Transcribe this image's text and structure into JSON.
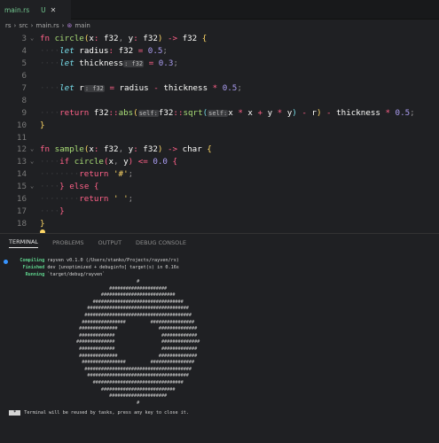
{
  "tab": {
    "name": "main.rs",
    "status": "U",
    "close": "✕"
  },
  "breadcrumb": [
    "rs",
    "src",
    "main.rs",
    "main"
  ],
  "code": [
    {
      "n": "3",
      "fold": true,
      "tokens": [
        [
          "kw",
          "fn "
        ],
        [
          "fn",
          "circle"
        ],
        [
          "p",
          "("
        ],
        [
          "id",
          "x"
        ],
        [
          "op",
          ": "
        ],
        [
          "ty",
          "f32"
        ],
        [
          "punct",
          ", "
        ],
        [
          "id",
          "y"
        ],
        [
          "op",
          ": "
        ],
        [
          "ty",
          "f32"
        ],
        [
          "p",
          ")"
        ],
        [
          "op",
          " -> "
        ],
        [
          "ty",
          "f32 "
        ],
        [
          "p",
          "{"
        ]
      ]
    },
    {
      "n": "4",
      "tokens": [
        [
          "ws",
          "····"
        ],
        [
          "let",
          "let "
        ],
        [
          "id",
          "radius"
        ],
        [
          "op",
          ": "
        ],
        [
          "ty",
          "f32 "
        ],
        [
          "op",
          "= "
        ],
        [
          "num",
          "0.5"
        ],
        [
          "punct",
          ";"
        ]
      ]
    },
    {
      "n": "5",
      "tokens": [
        [
          "ws",
          "····"
        ],
        [
          "let",
          "let "
        ],
        [
          "id",
          "thickness"
        ],
        [
          "hint",
          ": f32"
        ],
        [
          "op",
          " = "
        ],
        [
          "num",
          "0.3"
        ],
        [
          "punct",
          ";"
        ]
      ]
    },
    {
      "n": "6",
      "tokens": []
    },
    {
      "n": "7",
      "tokens": [
        [
          "ws",
          "····"
        ],
        [
          "let",
          "let "
        ],
        [
          "id",
          "r"
        ],
        [
          "hint",
          ": f32"
        ],
        [
          "op",
          " = "
        ],
        [
          "id",
          "radius "
        ],
        [
          "op",
          "- "
        ],
        [
          "id",
          "thickness "
        ],
        [
          "op",
          "* "
        ],
        [
          "num",
          "0.5"
        ],
        [
          "punct",
          ";"
        ]
      ]
    },
    {
      "n": "8",
      "tokens": []
    },
    {
      "n": "9",
      "tokens": [
        [
          "ws",
          "····"
        ],
        [
          "kw",
          "return "
        ],
        [
          "ty",
          "f32"
        ],
        [
          "op",
          "::"
        ],
        [
          "fn",
          "abs"
        ],
        [
          "p",
          "("
        ],
        [
          "hint",
          "self:"
        ],
        [
          "ty",
          "f32"
        ],
        [
          "op",
          "::"
        ],
        [
          "fn",
          "sqrt"
        ],
        [
          "p2",
          "("
        ],
        [
          "hint",
          "self:"
        ],
        [
          "id",
          "x "
        ],
        [
          "op",
          "* "
        ],
        [
          "id",
          "x "
        ],
        [
          "op",
          "+ "
        ],
        [
          "id",
          "y "
        ],
        [
          "op",
          "* "
        ],
        [
          "id",
          "y"
        ],
        [
          "p2",
          ")"
        ],
        [
          "op",
          " - "
        ],
        [
          "id",
          "r"
        ],
        [
          "p",
          ")"
        ],
        [
          "op",
          " - "
        ],
        [
          "id",
          "thickness "
        ],
        [
          "op",
          "* "
        ],
        [
          "num",
          "0.5"
        ],
        [
          "punct",
          ";"
        ]
      ]
    },
    {
      "n": "10",
      "tokens": [
        [
          "p",
          "}"
        ]
      ]
    },
    {
      "n": "11",
      "tokens": []
    },
    {
      "n": "12",
      "fold": true,
      "tokens": [
        [
          "kw",
          "fn "
        ],
        [
          "fn",
          "sample"
        ],
        [
          "p",
          "("
        ],
        [
          "id",
          "x"
        ],
        [
          "op",
          ": "
        ],
        [
          "ty",
          "f32"
        ],
        [
          "punct",
          ", "
        ],
        [
          "id",
          "y"
        ],
        [
          "op",
          ": "
        ],
        [
          "ty",
          "f32"
        ],
        [
          "p",
          ")"
        ],
        [
          "op",
          " -> "
        ],
        [
          "ty",
          "char "
        ],
        [
          "p",
          "{"
        ]
      ]
    },
    {
      "n": "13",
      "fold": true,
      "tokens": [
        [
          "ws",
          "····"
        ],
        [
          "kw",
          "if "
        ],
        [
          "fn",
          "circle"
        ],
        [
          "p3",
          "("
        ],
        [
          "id",
          "x"
        ],
        [
          "punct",
          ", "
        ],
        [
          "id",
          "y"
        ],
        [
          "p3",
          ")"
        ],
        [
          "op",
          " <= "
        ],
        [
          "num",
          "0.0 "
        ],
        [
          "p3",
          "{"
        ]
      ]
    },
    {
      "n": "14",
      "tokens": [
        [
          "ws",
          "········"
        ],
        [
          "kw",
          "return "
        ],
        [
          "str",
          "'#'"
        ],
        [
          "punct",
          ";"
        ]
      ]
    },
    {
      "n": "15",
      "fold": true,
      "tokens": [
        [
          "ws",
          "····"
        ],
        [
          "p3",
          "} "
        ],
        [
          "kw",
          "else "
        ],
        [
          "p3",
          "{"
        ]
      ]
    },
    {
      "n": "16",
      "tokens": [
        [
          "ws",
          "········"
        ],
        [
          "kw",
          "return "
        ],
        [
          "str",
          "' '"
        ],
        [
          "punct",
          ";"
        ]
      ]
    },
    {
      "n": "17",
      "tokens": [
        [
          "ws",
          "····"
        ],
        [
          "p3",
          "}"
        ]
      ]
    },
    {
      "n": "18",
      "tokens": [
        [
          "p",
          "}"
        ]
      ]
    }
  ],
  "panel": {
    "tabs": [
      "TERMINAL",
      "PROBLEMS",
      "OUTPUT",
      "DEBUG CONSOLE"
    ],
    "output": [
      {
        "label": "    Compiling",
        "text": " rayven v0.1.0 (/Users/stanko/Projects/rayven/rs)"
      },
      {
        "label": "     Finished",
        "text": " dev [unoptimized + debuginfo] target(s) in 0.16s"
      },
      {
        "label": "      Running",
        "text": " `target/debug/rayven`"
      }
    ],
    "art": [
      "                      #",
      "            #####################",
      "         ###########################",
      "      #################################",
      "    #####################################",
      "   #######################################",
      "  ################         ################",
      " ##############               ##############",
      " #############                 #############",
      "##############                 ##############",
      " #############                 #############",
      " ##############               ##############",
      "  ################         ################",
      "   #######################################",
      "    #####################################",
      "      #################################",
      "         ###########################",
      "            #####################",
      "                      #"
    ],
    "message_badge": " * ",
    "message": "Terminal will be reused by tasks, press any key to close it."
  }
}
